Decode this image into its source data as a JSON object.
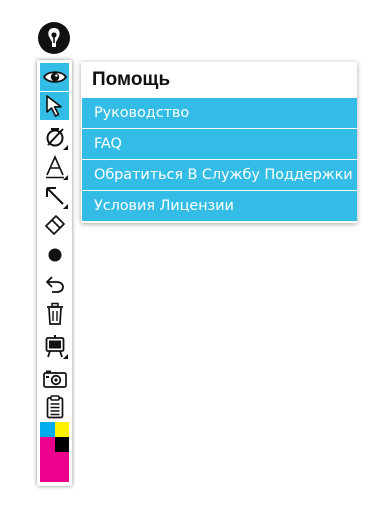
{
  "logo": {
    "icon": "pen-nib-icon"
  },
  "toolbar": {
    "tools": [
      {
        "name": "eye-icon",
        "active": true
      },
      {
        "name": "cursor-icon",
        "active": true
      },
      {
        "name": "no-shape-icon",
        "has_submenu": true
      },
      {
        "name": "text-icon",
        "has_submenu": true
      },
      {
        "name": "arrow-icon",
        "has_submenu": true
      },
      {
        "name": "eraser-icon"
      },
      {
        "name": "dot-icon"
      },
      {
        "name": "undo-icon"
      },
      {
        "name": "trash-icon"
      },
      {
        "name": "presentation-icon",
        "has_submenu": true
      },
      {
        "name": "camera-icon"
      },
      {
        "name": "clipboard-icon"
      }
    ],
    "swatches": {
      "cyan": "#00aeef",
      "yellow": "#fff200",
      "magenta": "#ec008c",
      "black": "#000000"
    },
    "accent": "#33bde6"
  },
  "help_menu": {
    "title": "Помощь",
    "items": [
      {
        "label": "Руководство"
      },
      {
        "label": "FAQ"
      },
      {
        "label": "Обратиться В Службу Поддержки"
      },
      {
        "label": "Условия Лицензии"
      }
    ]
  }
}
